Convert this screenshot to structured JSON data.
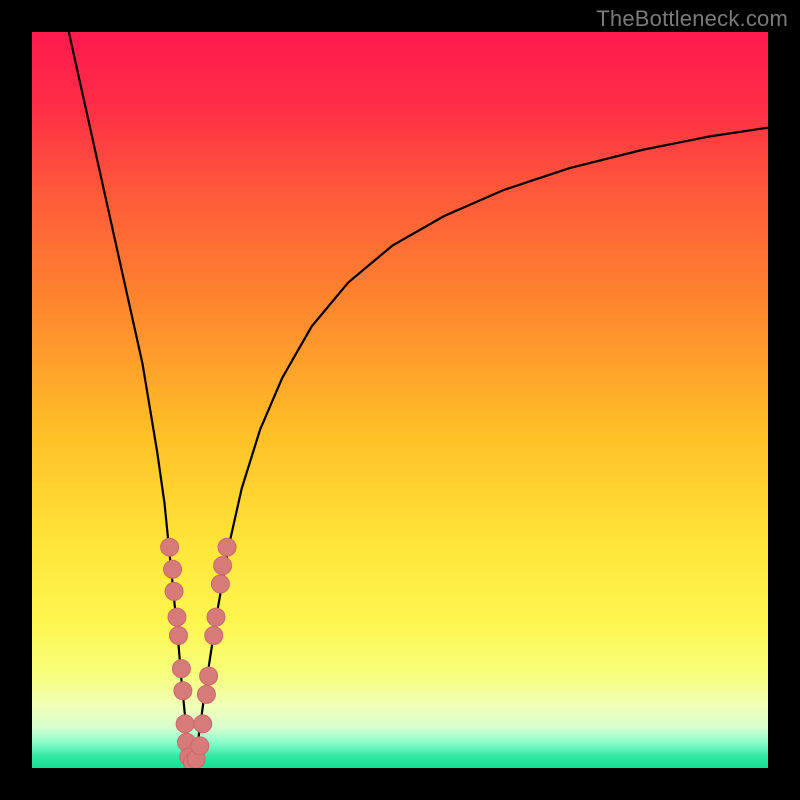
{
  "attribution": "TheBottleneck.com",
  "colors": {
    "bg": "#000000",
    "curve": "#000000",
    "marker_fill": "#d77a7a",
    "marker_stroke": "#c96a6a",
    "gradient_stops": [
      {
        "offset": 0.0,
        "color": "#ff1a4d"
      },
      {
        "offset": 0.1,
        "color": "#ff2e47"
      },
      {
        "offset": 0.22,
        "color": "#ff5a3a"
      },
      {
        "offset": 0.38,
        "color": "#ff8a2e"
      },
      {
        "offset": 0.55,
        "color": "#ffc227"
      },
      {
        "offset": 0.7,
        "color": "#ffe63a"
      },
      {
        "offset": 0.8,
        "color": "#fff64f"
      },
      {
        "offset": 0.87,
        "color": "#f7ff7a"
      },
      {
        "offset": 0.915,
        "color": "#f1ffb8"
      },
      {
        "offset": 0.945,
        "color": "#d8ffce"
      },
      {
        "offset": 0.965,
        "color": "#8dfccb"
      },
      {
        "offset": 0.985,
        "color": "#2ee9a2"
      },
      {
        "offset": 1.0,
        "color": "#17df93"
      }
    ]
  },
  "chart_data": {
    "type": "line",
    "title": "",
    "xlabel": "",
    "ylabel": "",
    "xlim": [
      0,
      100
    ],
    "ylim": [
      0,
      100
    ],
    "grid": false,
    "annotations": [
      "TheBottleneck.com"
    ],
    "series": [
      {
        "name": "curve-left",
        "x": [
          5,
          7,
          9,
          11,
          13,
          15,
          16,
          17,
          18,
          18.6,
          19.2,
          19.8,
          20.3,
          20.8,
          21.2,
          21.6
        ],
        "y": [
          100,
          91,
          82,
          73,
          64,
          55,
          49,
          43,
          36,
          30,
          24,
          18,
          12,
          7,
          3,
          0.5
        ]
      },
      {
        "name": "curve-right",
        "x": [
          22.0,
          22.6,
          23.3,
          24.2,
          25.3,
          26.7,
          28.5,
          31,
          34,
          38,
          43,
          49,
          56,
          64,
          73,
          83,
          92,
          100
        ],
        "y": [
          0.5,
          4,
          9,
          15,
          22,
          30,
          38,
          46,
          53,
          60,
          66,
          71,
          75,
          78.5,
          81.5,
          84,
          85.8,
          87
        ]
      }
    ],
    "markers": {
      "name": "highlight-points",
      "points": [
        {
          "x": 18.7,
          "y": 30
        },
        {
          "x": 19.1,
          "y": 27
        },
        {
          "x": 19.3,
          "y": 24
        },
        {
          "x": 19.7,
          "y": 20.5
        },
        {
          "x": 19.9,
          "y": 18
        },
        {
          "x": 20.3,
          "y": 13.5
        },
        {
          "x": 20.5,
          "y": 10.5
        },
        {
          "x": 20.8,
          "y": 6
        },
        {
          "x": 21.0,
          "y": 3.5
        },
        {
          "x": 21.3,
          "y": 1.5
        },
        {
          "x": 21.8,
          "y": 0.8
        },
        {
          "x": 22.3,
          "y": 1.2
        },
        {
          "x": 22.8,
          "y": 3
        },
        {
          "x": 23.2,
          "y": 6
        },
        {
          "x": 23.7,
          "y": 10
        },
        {
          "x": 24.0,
          "y": 12.5
        },
        {
          "x": 24.7,
          "y": 18
        },
        {
          "x": 25.0,
          "y": 20.5
        },
        {
          "x": 25.6,
          "y": 25
        },
        {
          "x": 25.9,
          "y": 27.5
        },
        {
          "x": 26.5,
          "y": 30
        }
      ]
    }
  }
}
